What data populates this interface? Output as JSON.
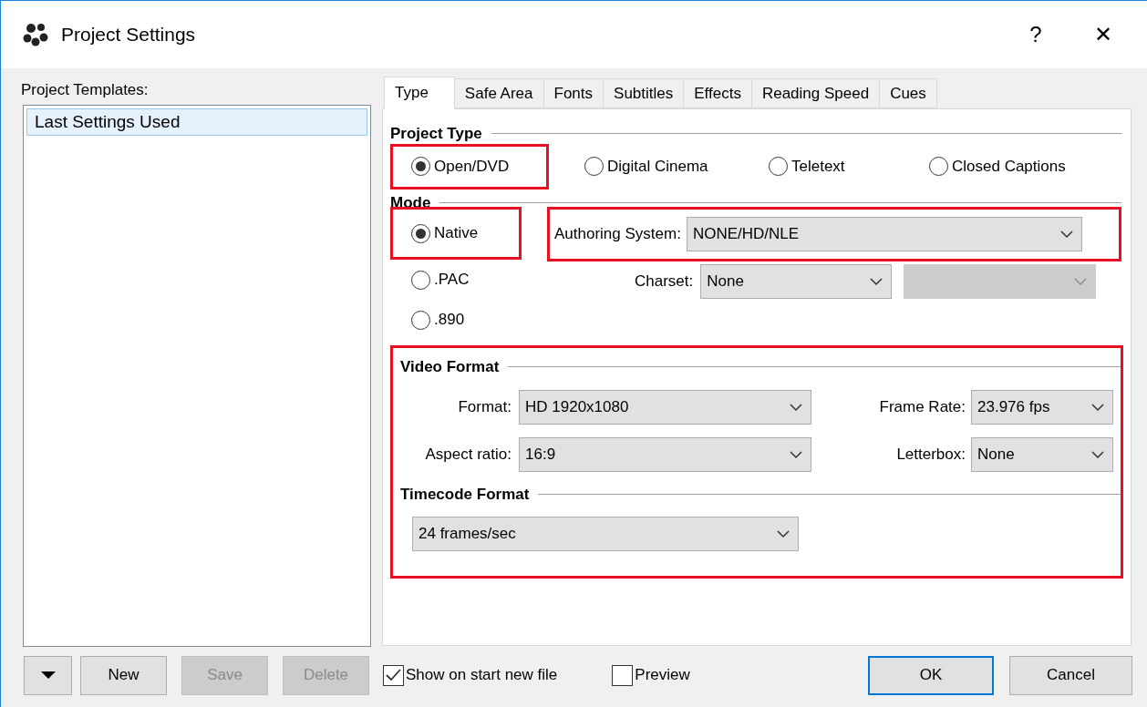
{
  "window": {
    "title": "Project Settings",
    "buttons": [
      "?",
      "✕"
    ]
  },
  "templates": {
    "label": "Project Templates:",
    "items": [
      {
        "label": "Last Settings Used",
        "selected": true
      }
    ]
  },
  "tabs": [
    {
      "label": "Type",
      "selected": true
    },
    {
      "label": "Safe Area",
      "selected": false
    },
    {
      "label": "Fonts",
      "selected": false
    },
    {
      "label": "Subtitles",
      "selected": false
    },
    {
      "label": "Effects",
      "selected": false
    },
    {
      "label": "Reading Speed",
      "selected": false
    },
    {
      "label": "Cues",
      "selected": false
    }
  ],
  "project_type": {
    "title": "Project Type",
    "options": [
      {
        "label": "Open/DVD",
        "selected": true,
        "highlighted": true
      },
      {
        "label": "Digital Cinema",
        "selected": false,
        "highlighted": false
      },
      {
        "label": "Teletext",
        "selected": false,
        "highlighted": false
      },
      {
        "label": "Closed Captions",
        "selected": false,
        "highlighted": false
      }
    ]
  },
  "mode": {
    "title": "Mode",
    "options": [
      {
        "label": "Native",
        "selected": true,
        "highlighted": true
      },
      {
        "label": ".PAC",
        "selected": false,
        "highlighted": false
      },
      {
        "label": ".890",
        "selected": false,
        "highlighted": false
      }
    ],
    "authoring_system": {
      "label": "Authoring System:",
      "value": "NONE/HD/NLE",
      "highlighted": true
    },
    "charset": {
      "label": "Charset:",
      "value": "None",
      "disabled": false
    },
    "charset_2": {
      "disabled": true
    }
  },
  "video_settings": {
    "highlighted": true,
    "video_format": {
      "title": "Video Format",
      "format": {
        "label": "Format:",
        "value": "HD 1920x1080"
      },
      "frame_rate": {
        "label": "Frame Rate:",
        "value": "23.976 fps"
      },
      "aspect_ratio": {
        "label": "Aspect ratio:",
        "value": "16:9"
      },
      "letterbox": {
        "label": "Letterbox:",
        "value": "None"
      }
    },
    "timecode_format": {
      "title": "Timecode Format",
      "value": "24 frames/sec"
    }
  },
  "footer": {
    "buttons": [
      {
        "label": "New",
        "disabled": false
      },
      {
        "label": "Save",
        "disabled": true
      },
      {
        "label": "Delete",
        "disabled": true
      }
    ],
    "checkboxes": [
      {
        "label": "Show on start new file",
        "checked": true
      },
      {
        "label": "Preview",
        "checked": false
      }
    ],
    "ok": "OK",
    "cancel": "Cancel"
  }
}
